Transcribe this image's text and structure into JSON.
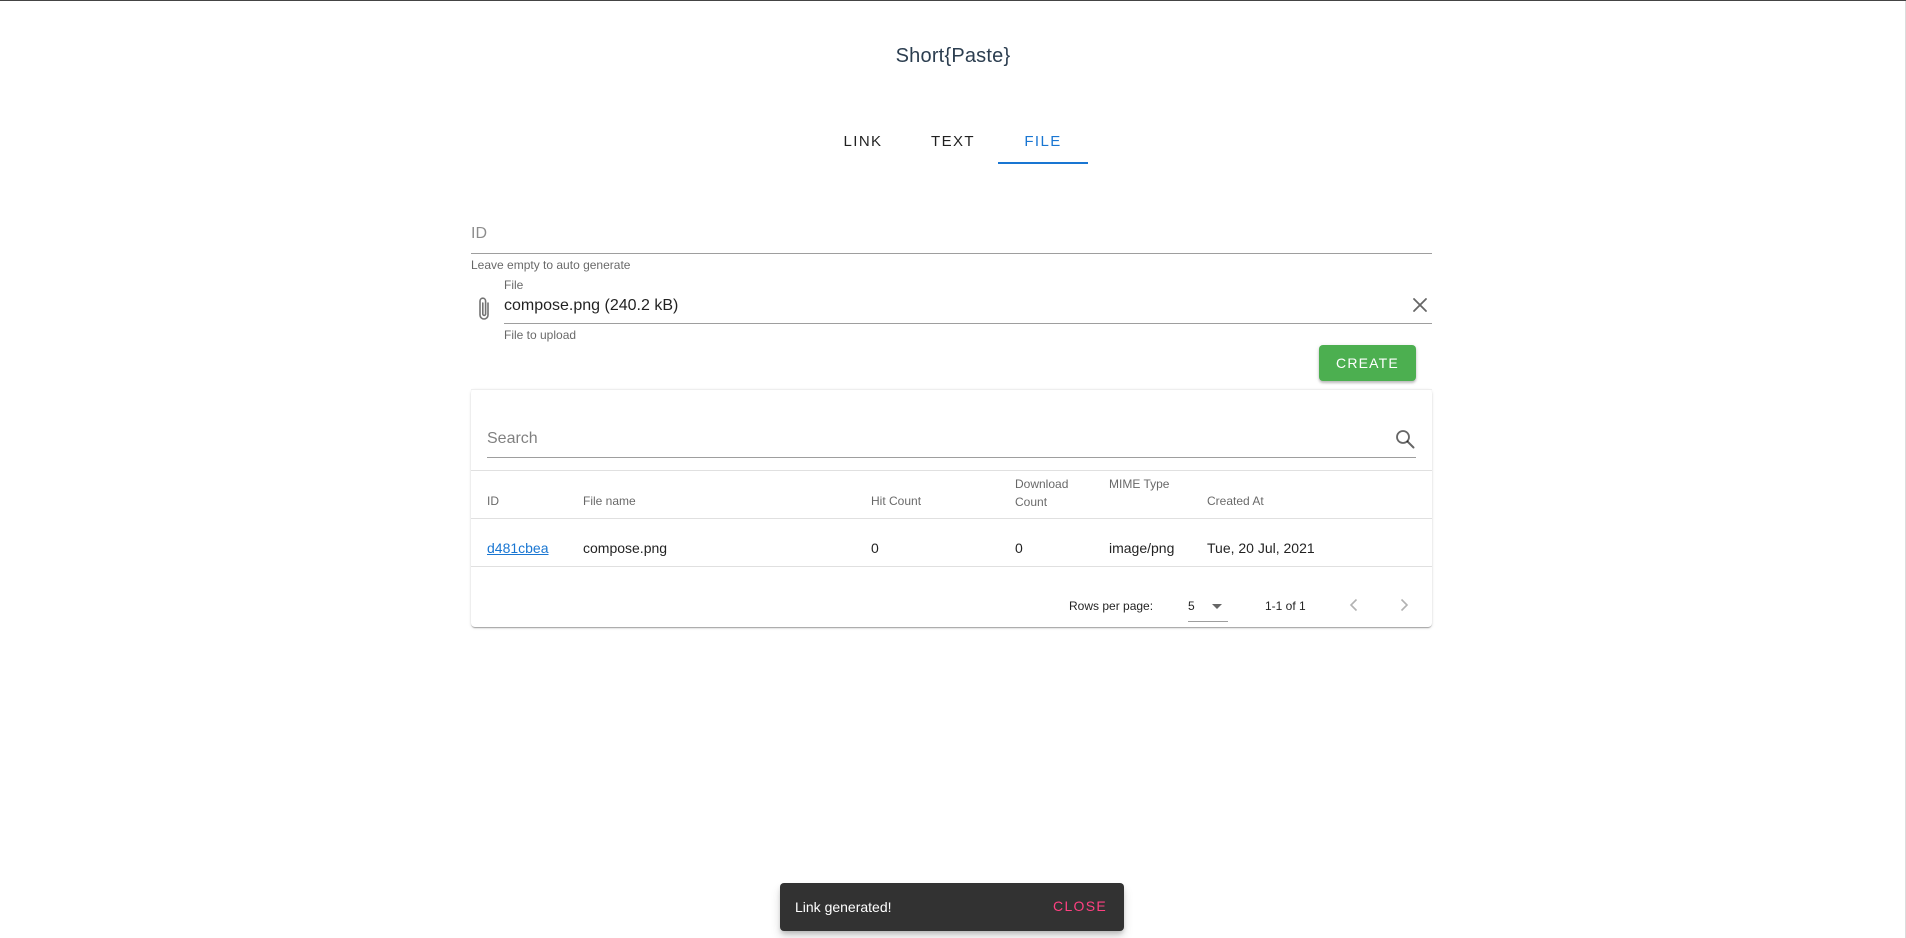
{
  "app": {
    "title": "Short{Paste}"
  },
  "tabs": [
    {
      "label": "LINK",
      "active": false
    },
    {
      "label": "TEXT",
      "active": false
    },
    {
      "label": "FILE",
      "active": true
    }
  ],
  "form": {
    "id_placeholder": "ID",
    "id_hint": "Leave empty to auto generate",
    "file_label": "File",
    "file_value": "compose.png (240.2 kB)",
    "file_hint": "File to upload",
    "create_label": "CREATE",
    "accent_color": "#4caf50"
  },
  "table": {
    "search_placeholder": "Search",
    "headers": {
      "id": "ID",
      "file_name": "File name",
      "hit_count": "Hit Count",
      "download_count_line1": "Download",
      "download_count_line2": "Count",
      "mime_type": "MIME Type",
      "created_at": "Created At"
    },
    "rows": [
      {
        "id": "d481cbea",
        "file_name": "compose.png",
        "hit_count": "0",
        "download_count": "0",
        "mime_type": "image/png",
        "created_at": "Tue, 20 Jul, 2021"
      }
    ],
    "footer": {
      "rows_per_page_label": "Rows per page:",
      "rows_per_page_value": "5",
      "page_info": "1-1 of 1"
    }
  },
  "snackbar": {
    "message": "Link generated!",
    "close_label": "CLOSE",
    "close_color": "#ff4081"
  },
  "colors": {
    "primary": "#1976d2",
    "title": "#2c3e50"
  }
}
